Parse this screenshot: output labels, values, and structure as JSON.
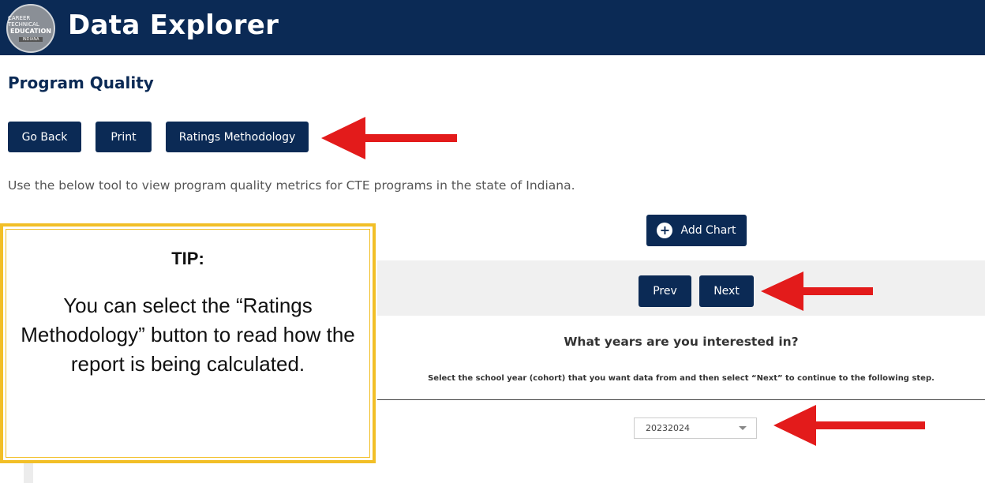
{
  "header": {
    "logo": {
      "line1": "CAREER TECHNICAL",
      "line2": "EDUCATION",
      "line3": "INDIANA",
      "icon": "cte-indiana-logo-icon"
    },
    "title": "Data Explorer"
  },
  "page": {
    "title": "Program Quality",
    "intro": "Use the below tool to view program quality metrics for CTE programs in the state of Indiana."
  },
  "toolbar": {
    "go_back": "Go Back",
    "print": "Print",
    "ratings_methodology": "Ratings Methodology"
  },
  "chart_controls": {
    "add_chart": "Add Chart",
    "add_chart_icon": "plus-circle-icon",
    "prev": "Prev",
    "next": "Next"
  },
  "step": {
    "question": "What years are you interested in?",
    "instruction": "Select the school year (cohort) that you want data from and then select “Next” to continue to the following step.",
    "year_select": {
      "value": "20232024"
    }
  },
  "tip": {
    "heading": "TIP:",
    "body": "You can select the “Ratings Methodology” button to read how the report is being calculated."
  },
  "colors": {
    "navy": "#0b2a55",
    "tip_border": "#f2bf27",
    "arrow": "#e31b1b"
  }
}
